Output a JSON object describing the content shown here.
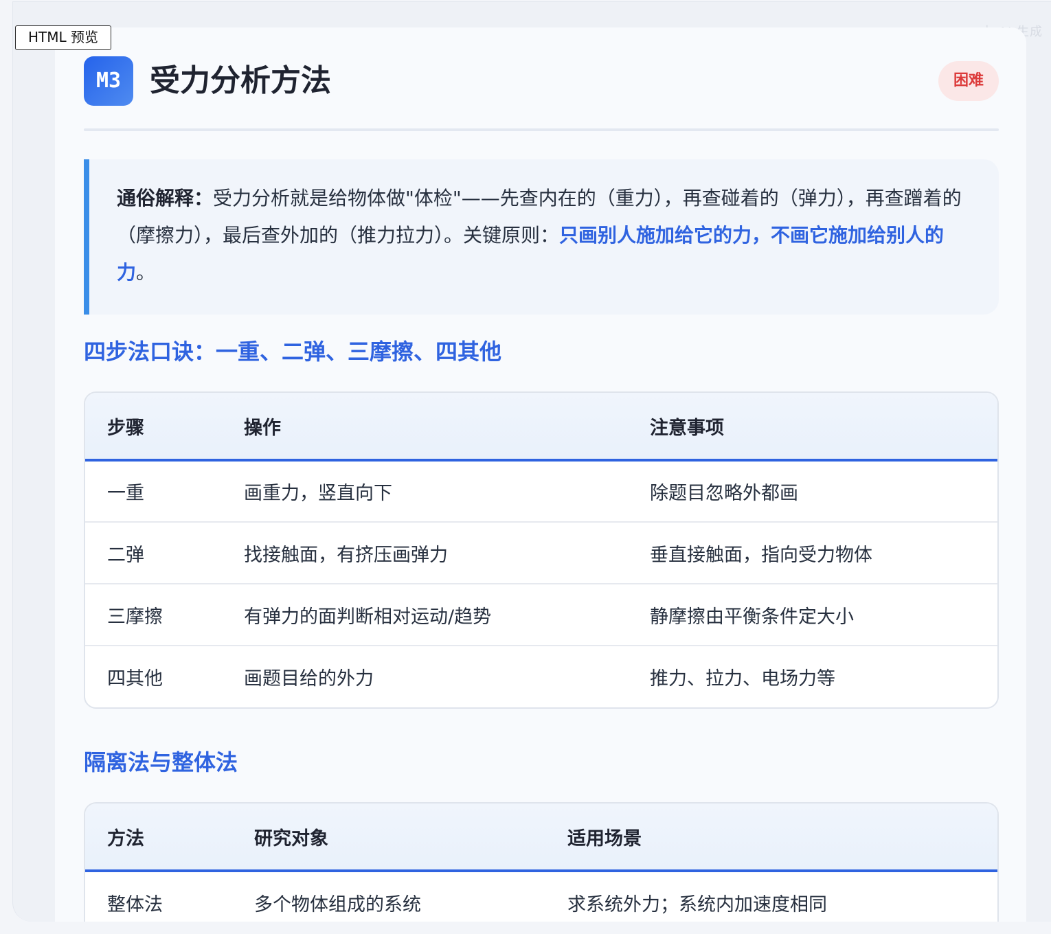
{
  "preview_label": "HTML 预览",
  "ai_mark": "由 AI 生成",
  "header": {
    "module_code": "M3",
    "title": "受力分析方法",
    "difficulty": "困难"
  },
  "callout": {
    "lead": "通俗解释：",
    "body": "受力分析就是给物体做\"体检\"——先查内在的（重力），再查碰着的（弹力），再查蹭着的（摩擦力），最后查外加的（推力拉力）。关键原则：",
    "highlight": "只画别人施加给它的力，不画它施加给别人的力",
    "end": "。"
  },
  "section1": {
    "heading": "四步法口诀：一重、二弹、三摩擦、四其他",
    "columns": [
      "步骤",
      "操作",
      "注意事项"
    ],
    "rows": [
      [
        "一重",
        "画重力，竖直向下",
        "除题目忽略外都画"
      ],
      [
        "二弹",
        "找接触面，有挤压画弹力",
        "垂直接触面，指向受力物体"
      ],
      [
        "三摩擦",
        "有弹力的面判断相对运动/趋势",
        "静摩擦由平衡条件定大小"
      ],
      [
        "四其他",
        "画题目给的外力",
        "推力、拉力、电场力等"
      ]
    ]
  },
  "section2": {
    "heading": "隔离法与整体法",
    "columns": [
      "方法",
      "研究对象",
      "适用场景"
    ],
    "rows": [
      [
        "整体法",
        "多个物体组成的系统",
        "求系统外力；系统内加速度相同"
      ]
    ]
  }
}
